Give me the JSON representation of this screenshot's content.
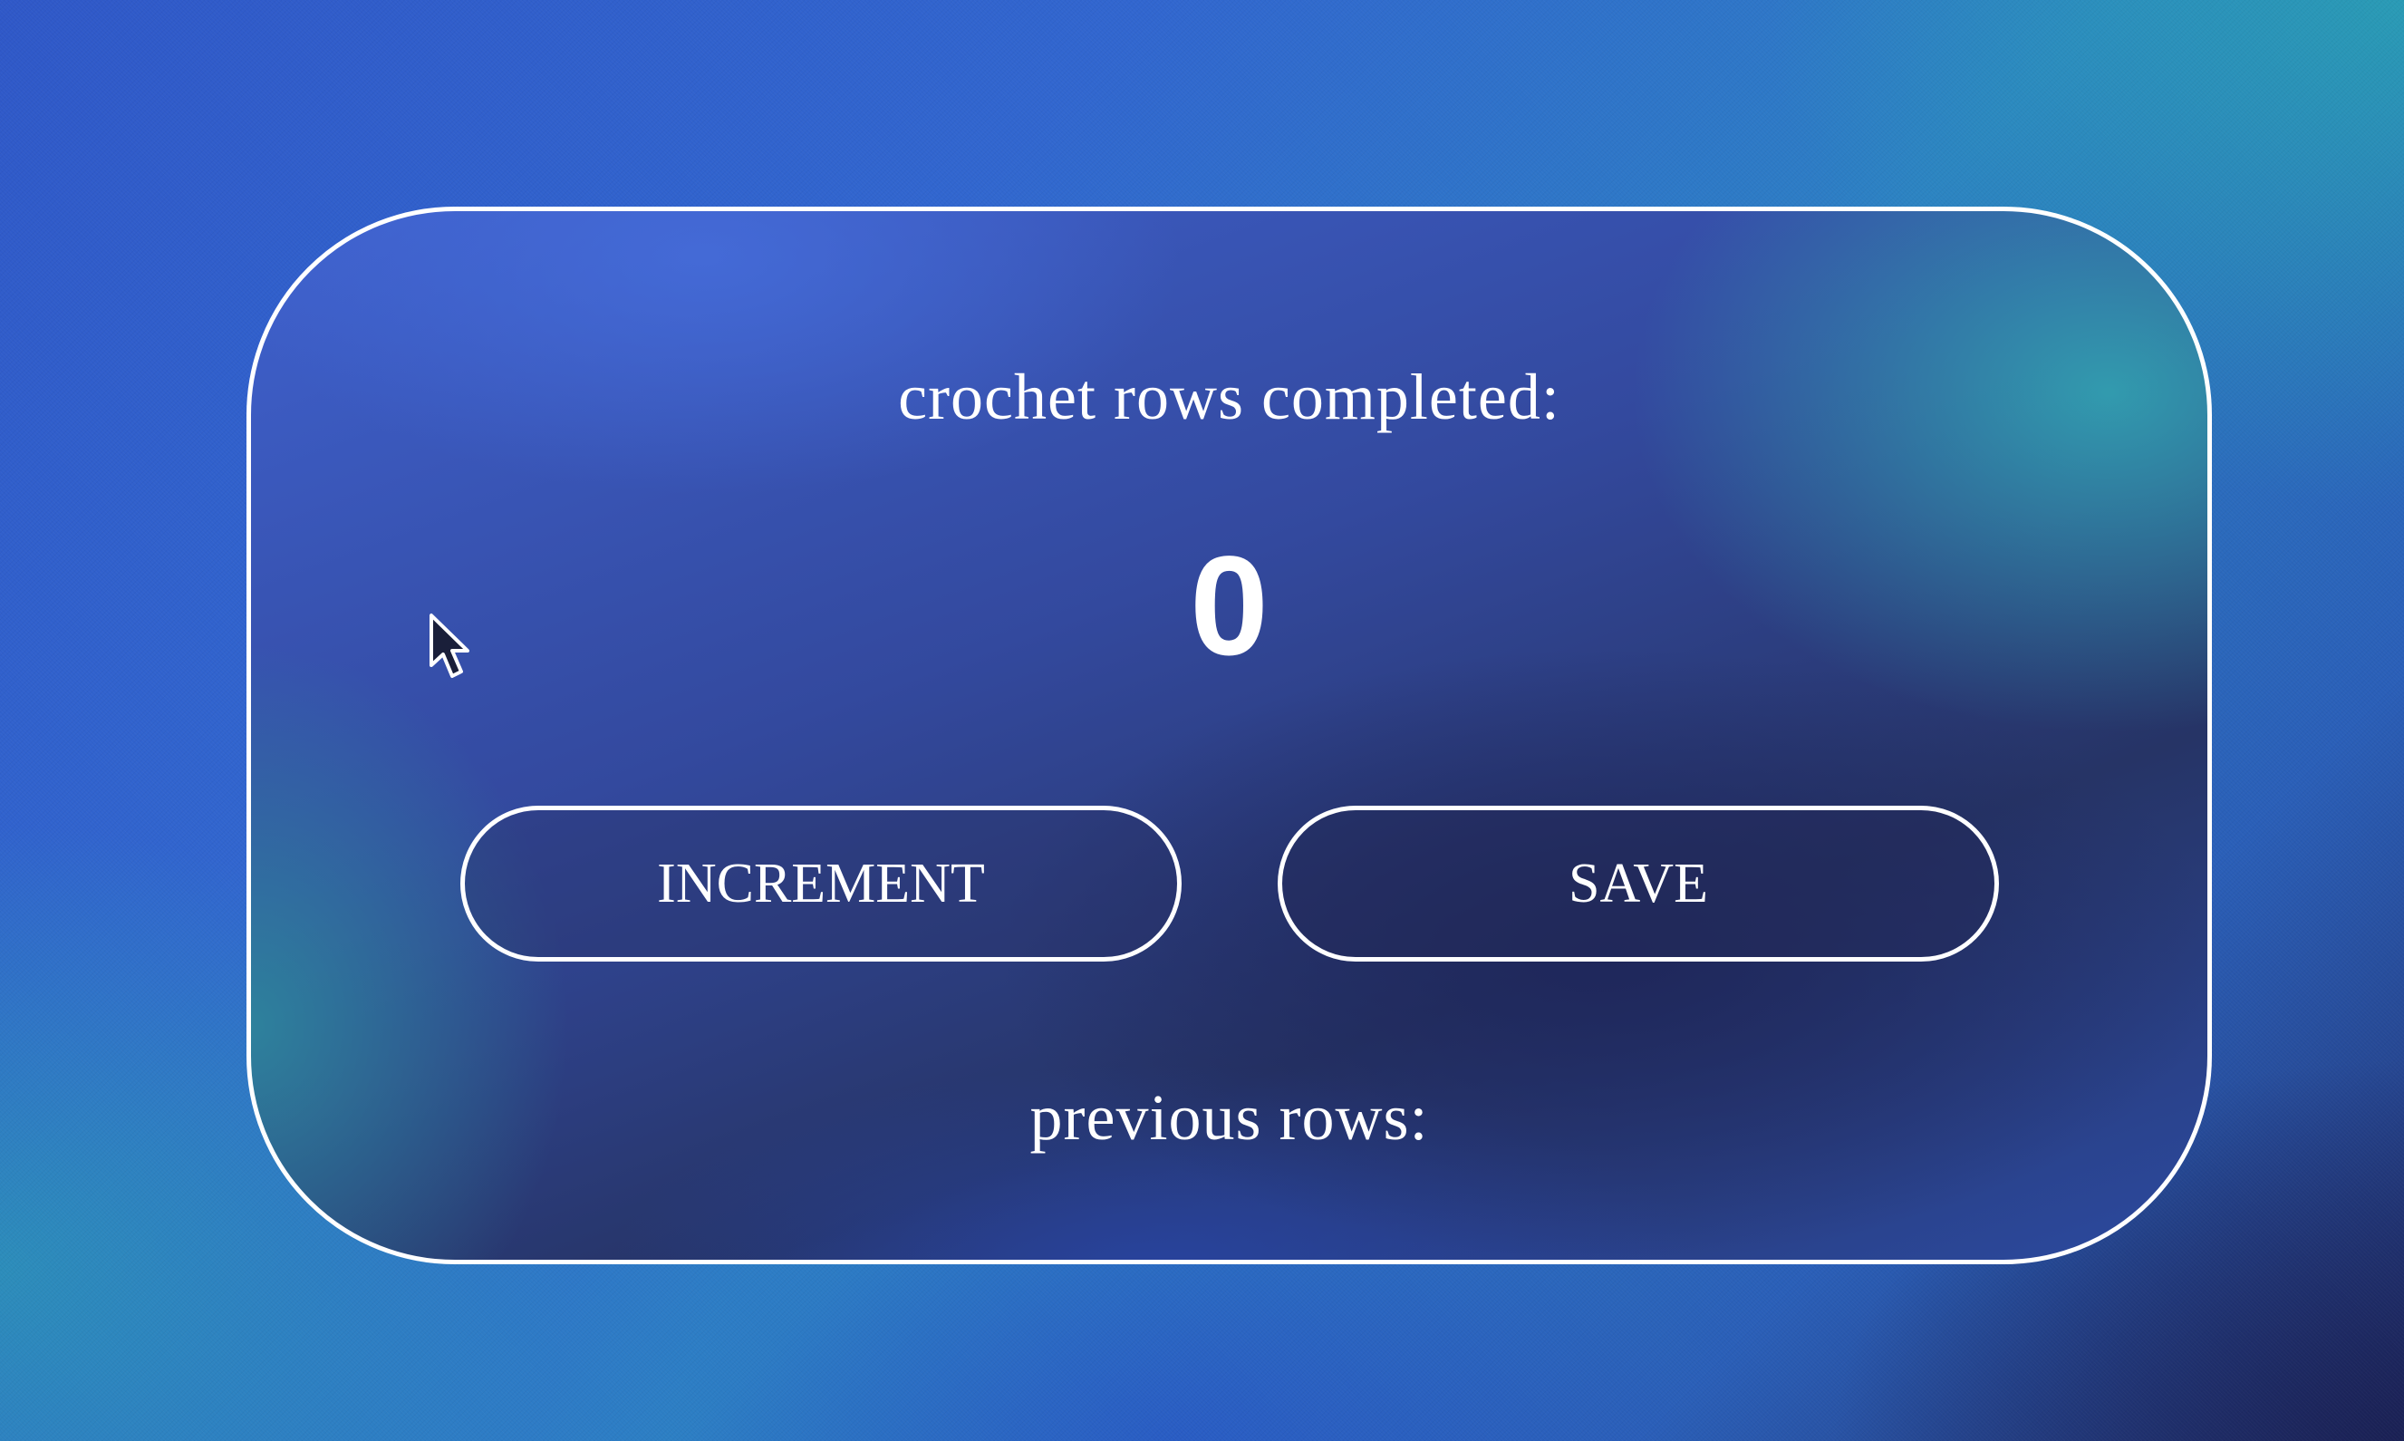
{
  "counter": {
    "heading": "crochet rows completed:",
    "value": "0"
  },
  "actions": {
    "increment_label": "INCREMENT",
    "save_label": "SAVE"
  },
  "history": {
    "heading": "previous rows:"
  },
  "colors": {
    "card_border": "#ffffff",
    "text": "#ffffff",
    "background_blue": "#3166cf",
    "background_teal": "#2c9aa8",
    "background_navy": "#22306e"
  },
  "icons": {
    "pointer": "mouse-pointer-icon"
  }
}
